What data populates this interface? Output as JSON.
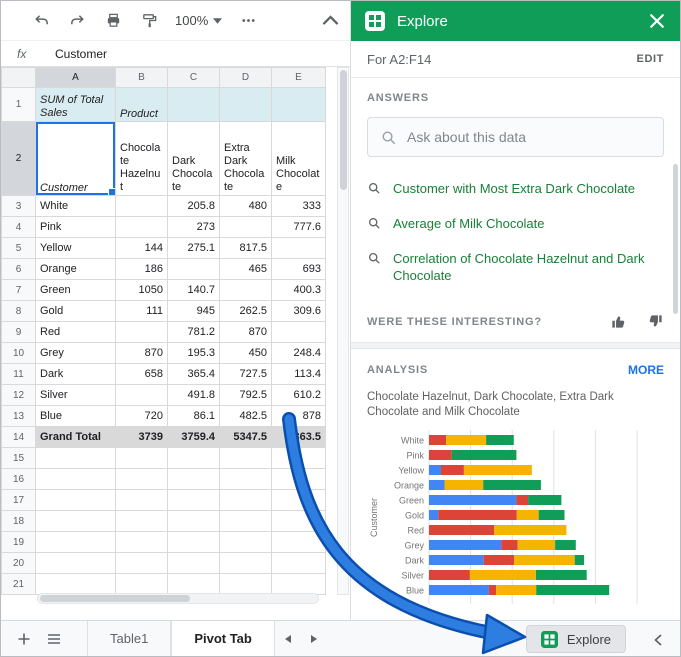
{
  "toolbar": {
    "zoom_value": "100%"
  },
  "formula_bar": {
    "fx_label": "fx",
    "value": "Customer"
  },
  "grid": {
    "column_letters": [
      "A",
      "B",
      "C",
      "D",
      "E"
    ],
    "row_numbers": [
      "1",
      "2",
      "3",
      "4",
      "5",
      "6",
      "7",
      "8",
      "9",
      "10",
      "11",
      "12",
      "13",
      "14",
      "15",
      "16",
      "17",
      "18",
      "19",
      "20",
      "21"
    ],
    "pivot_title": "SUM of Total Sales",
    "pivot_subtitle": "Product",
    "corner_header": "Customer",
    "column_headers": [
      "Chocolate Hazelnut",
      "Dark Chocolate",
      "Extra Dark Chocolate",
      "Milk Chocolate"
    ],
    "rows": [
      {
        "customer": "White",
        "values": [
          "",
          "205.8",
          "480",
          "333"
        ]
      },
      {
        "customer": "Pink",
        "values": [
          "",
          "273",
          "",
          "777.6"
        ]
      },
      {
        "customer": "Yellow",
        "values": [
          "144",
          "275.1",
          "817.5",
          ""
        ]
      },
      {
        "customer": "Orange",
        "values": [
          "186",
          "",
          "465",
          "693"
        ]
      },
      {
        "customer": "Green",
        "values": [
          "1050",
          "140.7",
          "",
          "400.3"
        ]
      },
      {
        "customer": "Gold",
        "values": [
          "111",
          "945",
          "262.5",
          "309.6"
        ]
      },
      {
        "customer": "Red",
        "values": [
          "",
          "781.2",
          "870",
          ""
        ]
      },
      {
        "customer": "Grey",
        "values": [
          "870",
          "195.3",
          "450",
          "248.4"
        ]
      },
      {
        "customer": "Dark",
        "values": [
          "658",
          "365.4",
          "727.5",
          "113.4"
        ]
      },
      {
        "customer": "Silver",
        "values": [
          "",
          "491.8",
          "792.5",
          "610.2"
        ]
      },
      {
        "customer": "Blue",
        "values": [
          "720",
          "86.1",
          "482.5",
          "878"
        ]
      }
    ],
    "grand_total": {
      "label": "Grand Total",
      "values": [
        "3739",
        "3759.4",
        "5347.5",
        "4363.5"
      ]
    }
  },
  "sheetbar": {
    "tabs": [
      {
        "label": "Table1",
        "active": false
      },
      {
        "label": "Pivot Tab",
        "active": true
      }
    ],
    "explore_label": "Explore"
  },
  "explore": {
    "title": "Explore",
    "range_label": "For A2:F14",
    "edit_label": "EDIT",
    "answers": {
      "heading": "ANSWERS",
      "search_placeholder": "Ask about this data",
      "suggestions": [
        "Customer with Most Extra Dark Chocolate",
        "Average of Milk Chocolate",
        "Correlation of Chocolate Hazelnut and Dark Chocolate"
      ]
    },
    "feedback": {
      "question": "WERE THESE INTERESTING?"
    },
    "analysis": {
      "heading": "ANALYSIS",
      "more_label": "MORE"
    }
  },
  "chart_data": {
    "type": "bar",
    "orientation": "horizontal",
    "stacked": true,
    "title": "Chocolate Hazelnut, Dark Chocolate, Extra Dark Chocolate and Milk Chocolate",
    "xlabel": "",
    "ylabel": "Customer",
    "xlim": [
      0,
      2500
    ],
    "grid": true,
    "categories": [
      "White",
      "Pink",
      "Yellow",
      "Orange",
      "Green",
      "Gold",
      "Red",
      "Grey",
      "Dark",
      "Silver",
      "Blue"
    ],
    "series": [
      {
        "name": "Chocolate Hazelnut",
        "color": "#4285f4",
        "values": [
          0,
          0,
          144,
          186,
          1050,
          111,
          0,
          870,
          658,
          0,
          720
        ]
      },
      {
        "name": "Dark Chocolate",
        "color": "#db4437",
        "values": [
          205.8,
          273,
          275.1,
          0,
          140.7,
          945,
          781.2,
          195.3,
          365.4,
          491.8,
          86.1
        ]
      },
      {
        "name": "Extra Dark Chocolate",
        "color": "#f4b400",
        "values": [
          480,
          0,
          817.5,
          465,
          0,
          262.5,
          870,
          450,
          727.5,
          792.5,
          482.5
        ]
      },
      {
        "name": "Milk Chocolate",
        "color": "#0f9d58",
        "values": [
          333,
          777.6,
          0,
          693,
          400.3,
          309.6,
          0,
          248.4,
          113.4,
          610.2,
          878
        ]
      }
    ]
  },
  "colors": {
    "explore_green": "#0f9d58",
    "link_blue": "#1a73e8",
    "arrow_blue": "#2e7de1",
    "arrow_outline": "#0b4fae",
    "pivot_header_bg": "#d9ecf2",
    "grand_total_bg": "#d9d9d9",
    "selection_blue": "#1a73e8"
  }
}
